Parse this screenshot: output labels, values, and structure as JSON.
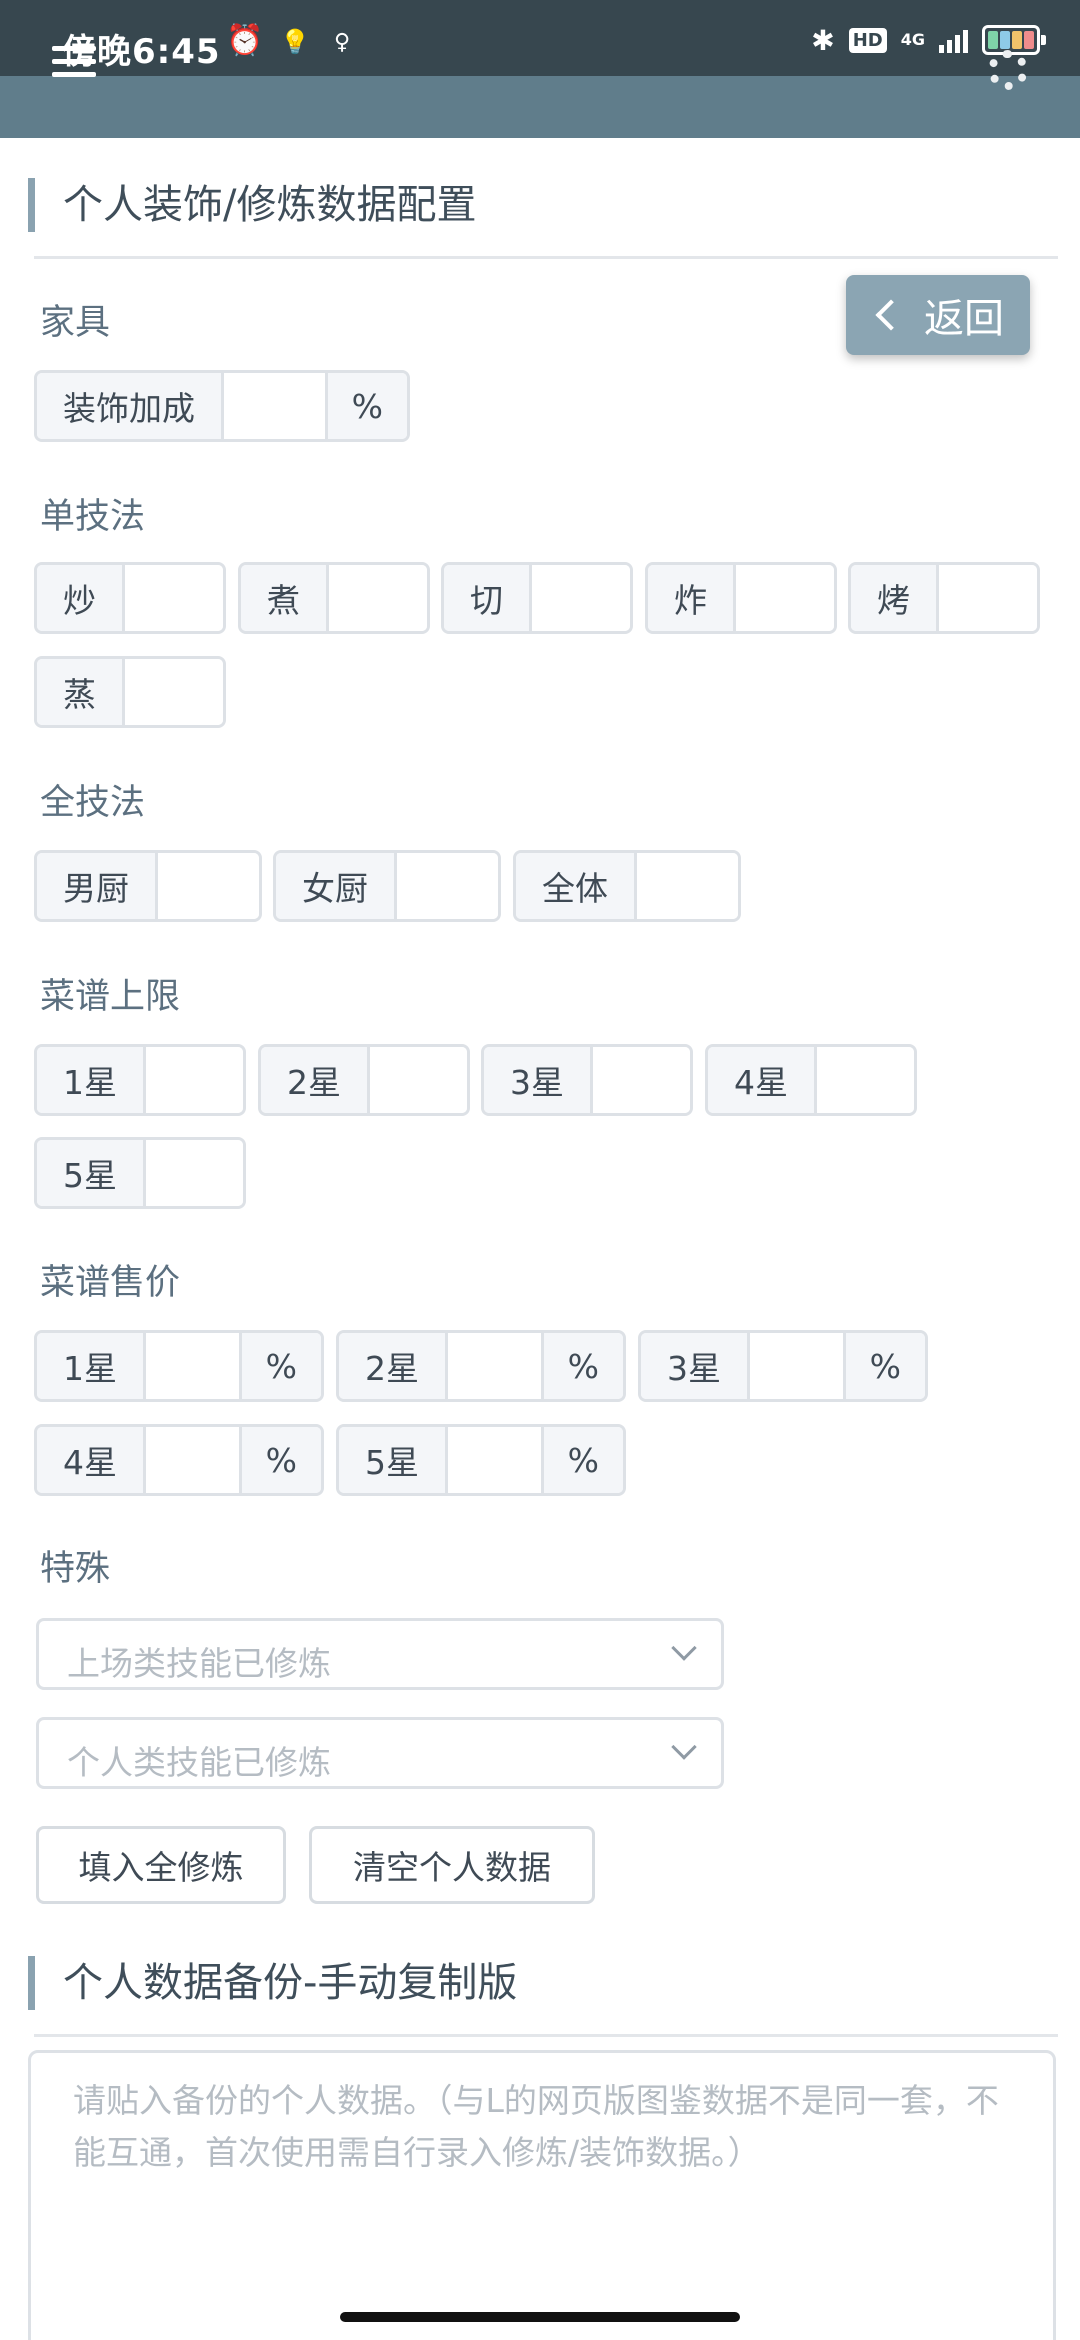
{
  "status_bar": {
    "time": "傍晚6:45",
    "network": "4G",
    "hd": "HD",
    "icons": [
      "alarm-icon",
      "bulb-icon",
      "bulb-outline-icon",
      "bluetooth-icon",
      "signal-icon",
      "battery-icon"
    ]
  },
  "appbar": {
    "menu_icon": "menu-icon",
    "settings_icon": "gear-icon",
    "color": "#607d8b"
  },
  "section1": {
    "title": "个人装饰/修炼数据配置"
  },
  "back_button": {
    "label": "返回"
  },
  "furniture": {
    "label": "家具",
    "items": [
      {
        "label": "装饰加成",
        "value": "",
        "suffix": "%"
      }
    ]
  },
  "single_skill": {
    "label": "单技法",
    "items": [
      {
        "label": "炒",
        "value": ""
      },
      {
        "label": "煮",
        "value": ""
      },
      {
        "label": "切",
        "value": ""
      },
      {
        "label": "炸",
        "value": ""
      },
      {
        "label": "烤",
        "value": ""
      },
      {
        "label": "蒸",
        "value": ""
      }
    ]
  },
  "all_skill": {
    "label": "全技法",
    "items": [
      {
        "label": "男厨",
        "value": ""
      },
      {
        "label": "女厨",
        "value": ""
      },
      {
        "label": "全体",
        "value": ""
      }
    ]
  },
  "recipe_limit": {
    "label": "菜谱上限",
    "items": [
      {
        "label": "1星",
        "value": ""
      },
      {
        "label": "2星",
        "value": ""
      },
      {
        "label": "3星",
        "value": ""
      },
      {
        "label": "4星",
        "value": ""
      },
      {
        "label": "5星",
        "value": ""
      }
    ]
  },
  "recipe_price": {
    "label": "菜谱售价",
    "items": [
      {
        "label": "1星",
        "value": "",
        "suffix": "%"
      },
      {
        "label": "2星",
        "value": "",
        "suffix": "%"
      },
      {
        "label": "3星",
        "value": "",
        "suffix": "%"
      },
      {
        "label": "4星",
        "value": "",
        "suffix": "%"
      },
      {
        "label": "5星",
        "value": "",
        "suffix": "%"
      }
    ]
  },
  "special": {
    "label": "特殊",
    "select1_placeholder": "上场类技能已修炼",
    "select2_placeholder": "个人类技能已修炼",
    "fill_all_button": "填入全修炼",
    "clear_button": "清空个人数据"
  },
  "section2": {
    "title": "个人数据备份-手动复制版",
    "textarea_placeholder": "请贴入备份的个人数据。（与L的网页版图鉴数据不是同一套，不能互通，首次使用需自行录入修炼/装饰数据。）"
  }
}
